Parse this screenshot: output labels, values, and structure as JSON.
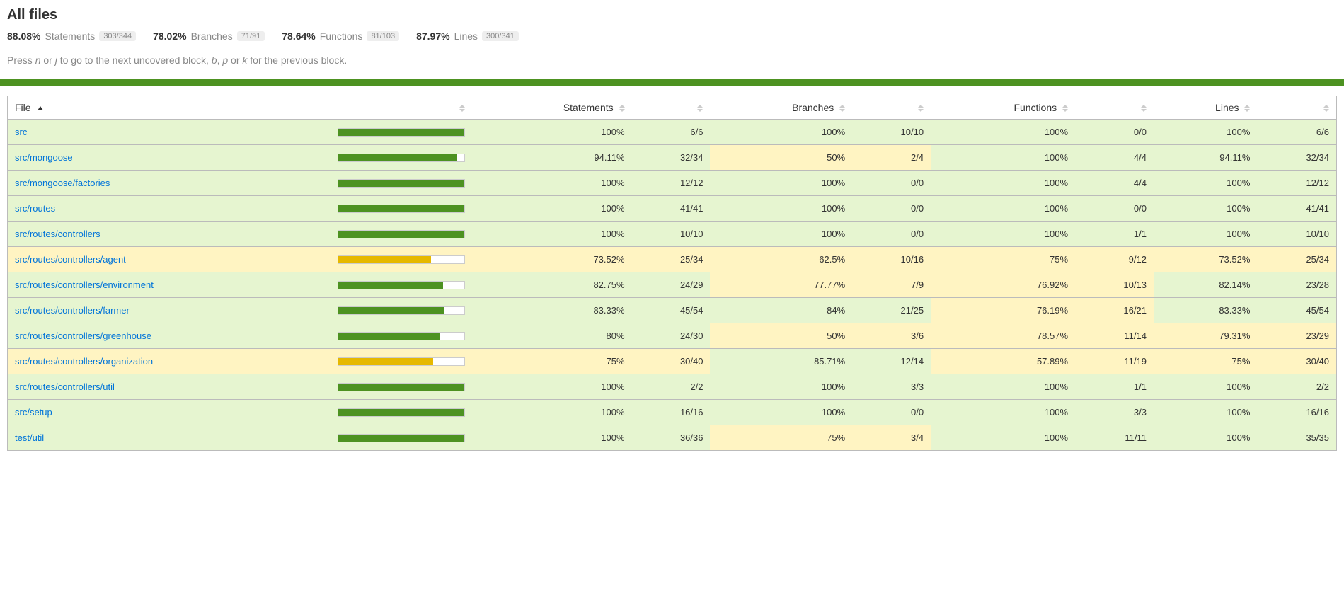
{
  "title": "All files",
  "summary": [
    {
      "pct": "88.08%",
      "label": "Statements",
      "count": "303/344"
    },
    {
      "pct": "78.02%",
      "label": "Branches",
      "count": "71/91"
    },
    {
      "pct": "78.64%",
      "label": "Functions",
      "count": "81/103"
    },
    {
      "pct": "87.97%",
      "label": "Lines",
      "count": "300/341"
    }
  ],
  "hint_parts": {
    "p1": "Press ",
    "k1": "n",
    "p2": " or ",
    "k2": "j",
    "p3": " to go to the next uncovered block, ",
    "k3": "b",
    "p4": ", ",
    "k4": "p",
    "p5": " or ",
    "k5": "k",
    "p6": " for the previous block."
  },
  "columns": {
    "file": "File",
    "statements": "Statements",
    "branches": "Branches",
    "functions": "Functions",
    "lines": "Lines"
  },
  "rows": [
    {
      "file": "src",
      "bar_pct": 100,
      "bar_level": "high",
      "stmt_pct": "100%",
      "stmt_cnt": "6/6",
      "stmt_level": "high",
      "br_pct": "100%",
      "br_cnt": "10/10",
      "br_level": "high",
      "fn_pct": "100%",
      "fn_cnt": "0/0",
      "fn_level": "high",
      "ln_pct": "100%",
      "ln_cnt": "6/6",
      "ln_level": "high"
    },
    {
      "file": "src/mongoose",
      "bar_pct": 94.11,
      "bar_level": "high",
      "stmt_pct": "94.11%",
      "stmt_cnt": "32/34",
      "stmt_level": "high",
      "br_pct": "50%",
      "br_cnt": "2/4",
      "br_level": "medium",
      "fn_pct": "100%",
      "fn_cnt": "4/4",
      "fn_level": "high",
      "ln_pct": "94.11%",
      "ln_cnt": "32/34",
      "ln_level": "high"
    },
    {
      "file": "src/mongoose/factories",
      "bar_pct": 100,
      "bar_level": "high",
      "stmt_pct": "100%",
      "stmt_cnt": "12/12",
      "stmt_level": "high",
      "br_pct": "100%",
      "br_cnt": "0/0",
      "br_level": "high",
      "fn_pct": "100%",
      "fn_cnt": "4/4",
      "fn_level": "high",
      "ln_pct": "100%",
      "ln_cnt": "12/12",
      "ln_level": "high"
    },
    {
      "file": "src/routes",
      "bar_pct": 100,
      "bar_level": "high",
      "stmt_pct": "100%",
      "stmt_cnt": "41/41",
      "stmt_level": "high",
      "br_pct": "100%",
      "br_cnt": "0/0",
      "br_level": "high",
      "fn_pct": "100%",
      "fn_cnt": "0/0",
      "fn_level": "high",
      "ln_pct": "100%",
      "ln_cnt": "41/41",
      "ln_level": "high"
    },
    {
      "file": "src/routes/controllers",
      "bar_pct": 100,
      "bar_level": "high",
      "stmt_pct": "100%",
      "stmt_cnt": "10/10",
      "stmt_level": "high",
      "br_pct": "100%",
      "br_cnt": "0/0",
      "br_level": "high",
      "fn_pct": "100%",
      "fn_cnt": "1/1",
      "fn_level": "high",
      "ln_pct": "100%",
      "ln_cnt": "10/10",
      "ln_level": "high"
    },
    {
      "file": "src/routes/controllers/agent",
      "bar_pct": 73.52,
      "bar_level": "medium",
      "stmt_pct": "73.52%",
      "stmt_cnt": "25/34",
      "stmt_level": "medium",
      "br_pct": "62.5%",
      "br_cnt": "10/16",
      "br_level": "medium",
      "fn_pct": "75%",
      "fn_cnt": "9/12",
      "fn_level": "medium",
      "ln_pct": "73.52%",
      "ln_cnt": "25/34",
      "ln_level": "medium"
    },
    {
      "file": "src/routes/controllers/environment",
      "bar_pct": 82.75,
      "bar_level": "high",
      "stmt_pct": "82.75%",
      "stmt_cnt": "24/29",
      "stmt_level": "high",
      "br_pct": "77.77%",
      "br_cnt": "7/9",
      "br_level": "medium",
      "fn_pct": "76.92%",
      "fn_cnt": "10/13",
      "fn_level": "medium",
      "ln_pct": "82.14%",
      "ln_cnt": "23/28",
      "ln_level": "high"
    },
    {
      "file": "src/routes/controllers/farmer",
      "bar_pct": 83.33,
      "bar_level": "high",
      "stmt_pct": "83.33%",
      "stmt_cnt": "45/54",
      "stmt_level": "high",
      "br_pct": "84%",
      "br_cnt": "21/25",
      "br_level": "high",
      "fn_pct": "76.19%",
      "fn_cnt": "16/21",
      "fn_level": "medium",
      "ln_pct": "83.33%",
      "ln_cnt": "45/54",
      "ln_level": "high"
    },
    {
      "file": "src/routes/controllers/greenhouse",
      "bar_pct": 80,
      "bar_level": "high",
      "stmt_pct": "80%",
      "stmt_cnt": "24/30",
      "stmt_level": "high",
      "br_pct": "50%",
      "br_cnt": "3/6",
      "br_level": "medium",
      "fn_pct": "78.57%",
      "fn_cnt": "11/14",
      "fn_level": "medium",
      "ln_pct": "79.31%",
      "ln_cnt": "23/29",
      "ln_level": "medium"
    },
    {
      "file": "src/routes/controllers/organization",
      "bar_pct": 75,
      "bar_level": "medium",
      "stmt_pct": "75%",
      "stmt_cnt": "30/40",
      "stmt_level": "medium",
      "br_pct": "85.71%",
      "br_cnt": "12/14",
      "br_level": "high",
      "fn_pct": "57.89%",
      "fn_cnt": "11/19",
      "fn_level": "medium",
      "ln_pct": "75%",
      "ln_cnt": "30/40",
      "ln_level": "medium"
    },
    {
      "file": "src/routes/controllers/util",
      "bar_pct": 100,
      "bar_level": "high",
      "stmt_pct": "100%",
      "stmt_cnt": "2/2",
      "stmt_level": "high",
      "br_pct": "100%",
      "br_cnt": "3/3",
      "br_level": "high",
      "fn_pct": "100%",
      "fn_cnt": "1/1",
      "fn_level": "high",
      "ln_pct": "100%",
      "ln_cnt": "2/2",
      "ln_level": "high"
    },
    {
      "file": "src/setup",
      "bar_pct": 100,
      "bar_level": "high",
      "stmt_pct": "100%",
      "stmt_cnt": "16/16",
      "stmt_level": "high",
      "br_pct": "100%",
      "br_cnt": "0/0",
      "br_level": "high",
      "fn_pct": "100%",
      "fn_cnt": "3/3",
      "fn_level": "high",
      "ln_pct": "100%",
      "ln_cnt": "16/16",
      "ln_level": "high"
    },
    {
      "file": "test/util",
      "bar_pct": 100,
      "bar_level": "high",
      "stmt_pct": "100%",
      "stmt_cnt": "36/36",
      "stmt_level": "high",
      "br_pct": "75%",
      "br_cnt": "3/4",
      "br_level": "medium",
      "fn_pct": "100%",
      "fn_cnt": "11/11",
      "fn_level": "high",
      "ln_pct": "100%",
      "ln_cnt": "35/35",
      "ln_level": "high"
    }
  ]
}
